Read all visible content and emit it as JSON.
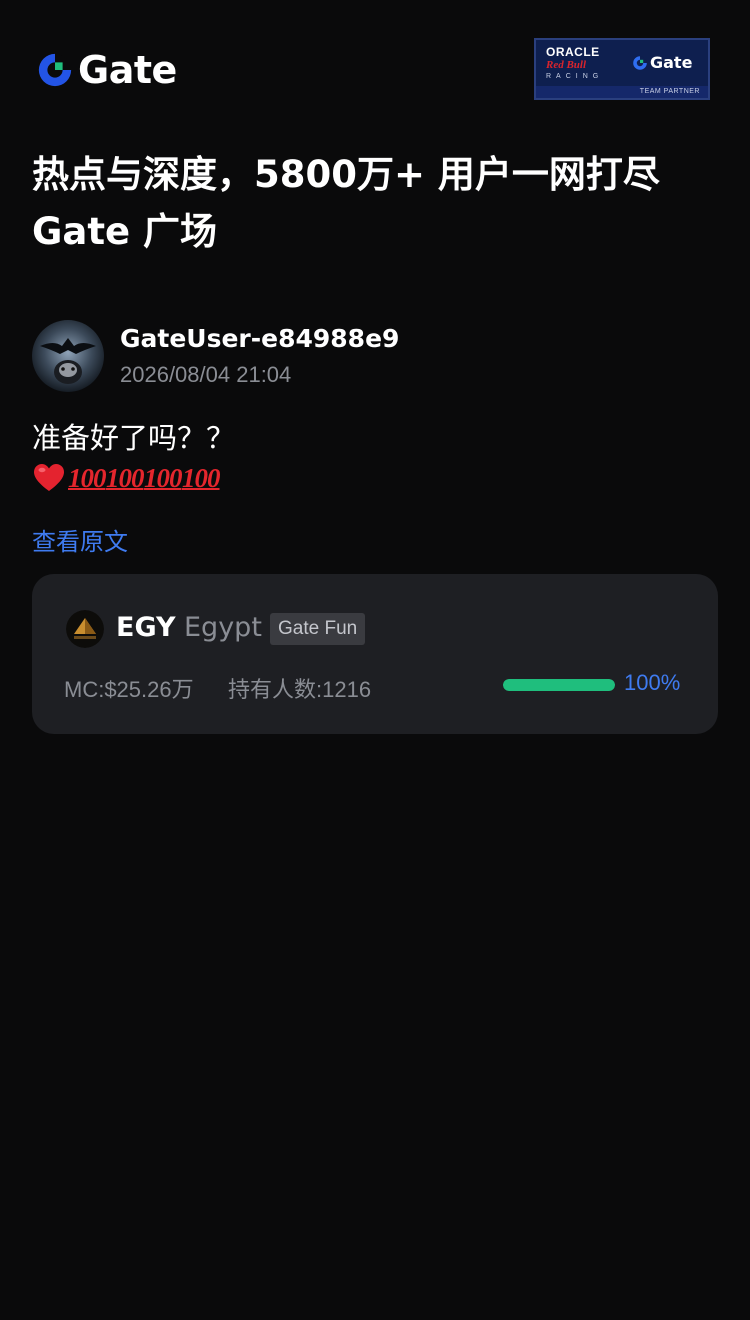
{
  "header": {
    "logo_text": "Gate",
    "partner": {
      "line1": "ORACLE",
      "line2": "Red Bull",
      "line3": "RACING",
      "gate_text": "Gate",
      "strip": "TEAM PARTNER"
    }
  },
  "headline": {
    "line1": "热点与深度，5800万+ 用户一网打尽",
    "line2": "Gate 广场"
  },
  "post": {
    "username": "GateUser-e84988e9",
    "timestamp": "2026/08/04 21:04",
    "text": "准备好了吗？？",
    "emojis": [
      "heart-icon",
      "hundred-points-icon",
      "hundred-points-icon",
      "hundred-points-icon",
      "hundred-points-icon"
    ],
    "view_original": "查看原文"
  },
  "token": {
    "symbol": "EGY",
    "name": "Egypt",
    "tag": "Gate Fun",
    "market_cap": "MC:$25.26万",
    "holders": "持有人数:1216",
    "progress": 1.0,
    "progress_label": "100%"
  },
  "colors": {
    "background": "#0a0a0b",
    "card": "#1e1f23",
    "accent_blue": "#3f7bf0",
    "progress_green": "#1fbe7d",
    "muted_text": "#8a8d94"
  }
}
